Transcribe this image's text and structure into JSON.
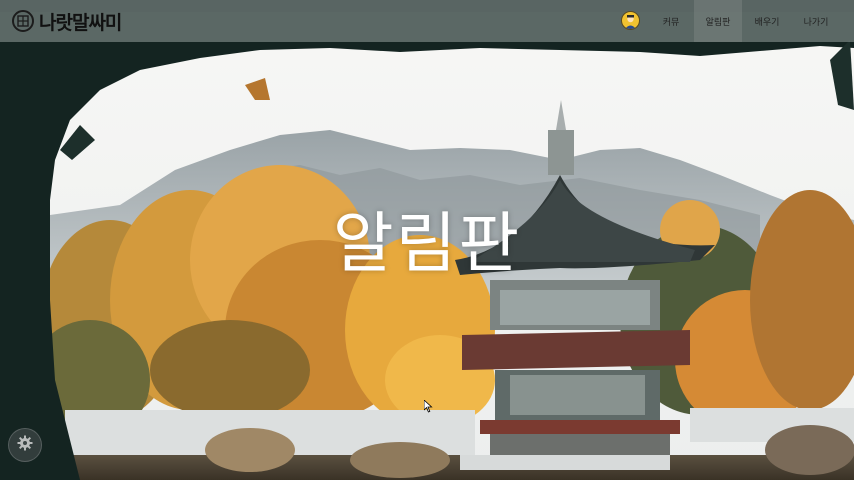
{
  "brand": {
    "name": "나랏말싸미",
    "logo_icon": "brand-seal-icon"
  },
  "nav": {
    "avatar_icon": "user-avatar-icon",
    "items": [
      {
        "label": "커뮤",
        "active": false
      },
      {
        "label": "알림판",
        "active": true
      },
      {
        "label": "배우기",
        "active": false
      },
      {
        "label": "나가기",
        "active": false
      }
    ]
  },
  "hero": {
    "title": "알림판"
  },
  "settings": {
    "icon": "gear-icon"
  },
  "colors": {
    "navbar": "#96a09e",
    "title": "#ffffff",
    "foliage": "#e0a040",
    "roof": "#3c4545"
  }
}
